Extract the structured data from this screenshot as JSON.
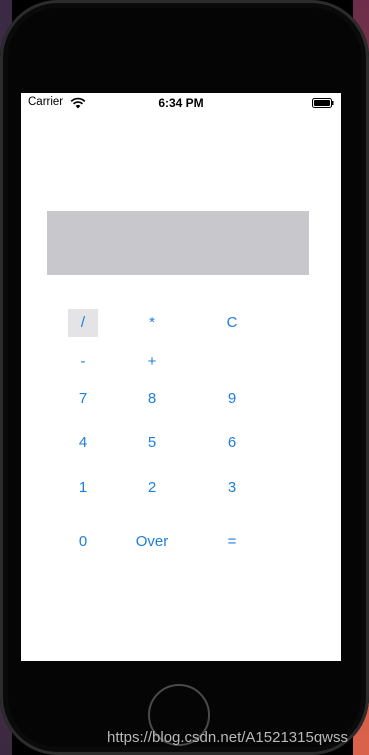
{
  "status_bar": {
    "carrier": "Carrier",
    "time": "6:34 PM"
  },
  "display": {
    "value": ""
  },
  "keypad": {
    "divide": "/",
    "multiply": "*",
    "clear": "C",
    "minus": "-",
    "plus": "+",
    "seven": "7",
    "eight": "8",
    "nine": "9",
    "four": "4",
    "five": "5",
    "six": "6",
    "one": "1",
    "two": "2",
    "three": "3",
    "zero": "0",
    "over": "Over",
    "equals": "="
  },
  "watermark": "https://blog.csdn.net/A1521315qwss",
  "colors": {
    "button_text": "#1e7fd9",
    "display_bg": "#c8c8cc",
    "highlight_bg": "#e4e4e6"
  }
}
